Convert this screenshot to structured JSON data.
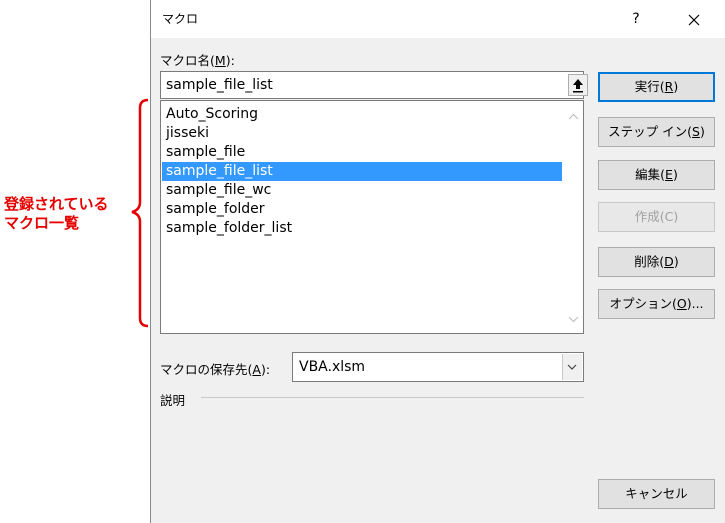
{
  "annotation": {
    "line1": "登録されている",
    "line2": "マクロ一覧",
    "color": "#e60000"
  },
  "dialog": {
    "title": "マクロ",
    "help_label": "?",
    "name_label_prefix": "マクロ名(",
    "name_label_key": "M",
    "name_label_suffix": "):",
    "name_value": "sample_file_list",
    "macros": [
      "Auto_Scoring",
      "jisseki",
      "sample_file",
      "sample_file_list",
      "sample_file_wc",
      "sample_folder",
      "sample_folder_list"
    ],
    "selected_index": 3,
    "buttons": {
      "run_prefix": "実行(",
      "run_key": "R",
      "run_suffix": ")",
      "step_prefix": "ステップ イン(",
      "step_key": "S",
      "step_suffix": ")",
      "edit_prefix": "編集(",
      "edit_key": "E",
      "edit_suffix": ")",
      "create": "作成(C)",
      "delete_prefix": "削除(",
      "delete_key": "D",
      "delete_suffix": ")",
      "options_prefix": "オプション(",
      "options_key": "O",
      "options_suffix": ")...",
      "cancel": "キャンセル"
    },
    "store_label_prefix": "マクロの保存先(",
    "store_label_key": "A",
    "store_label_suffix": "):",
    "store_value": "VBA.xlsm",
    "description_label": "説明",
    "accent_color": "#0078d7",
    "selection_color": "#3399ff"
  }
}
